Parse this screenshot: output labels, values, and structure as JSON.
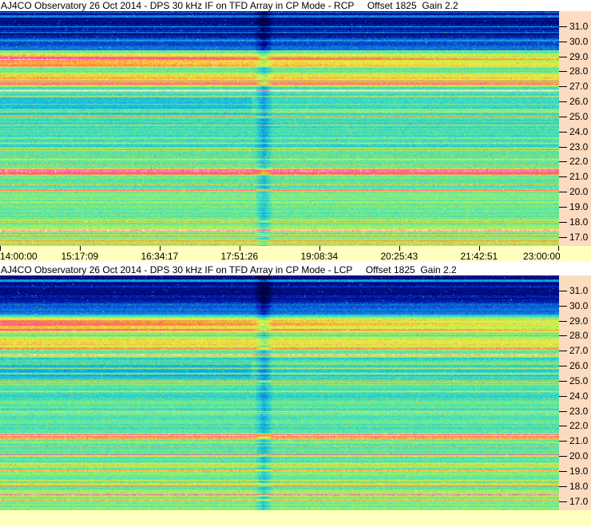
{
  "chart_data": [
    {
      "type": "heatmap",
      "title": "AJ4CO Observatory 26 Oct 2014 - DPS 30 kHz IF on TFD Array in CP Mode - RCP     Offset 1825  Gain 2.2",
      "y_ticks": [
        "31.0",
        "30.0",
        "29.0",
        "28.0",
        "27.0",
        "26.0",
        "25.0",
        "24.0",
        "23.0",
        "22.0",
        "21.0",
        "20.0",
        "19.0",
        "18.0",
        "17.0"
      ],
      "x_ticks": [
        "14:00:00",
        "15:17:09",
        "16:34:17",
        "17:51:26",
        "19:08:34",
        "20:25:43",
        "21:42:51",
        "23:00:00"
      ],
      "x_range": [
        "14:00:00",
        "23:00:00"
      ],
      "y_range": [
        16.4,
        32.0
      ],
      "polarization": "RCP"
    },
    {
      "type": "heatmap",
      "title": "AJ4CO Observatory 26 Oct 2014 - DPS 30 kHz IF on TFD Array in CP Mode - LCP     Offset 1825  Gain 2.2",
      "y_ticks": [
        "31.0",
        "30.0",
        "29.0",
        "28.0",
        "27.0",
        "26.0",
        "25.0",
        "24.0",
        "23.0",
        "22.0",
        "21.0",
        "20.0",
        "19.0",
        "18.0",
        "17.0"
      ],
      "x_ticks": [],
      "x_range": [
        "14:00:00",
        "23:00:00"
      ],
      "y_range": [
        16.4,
        32.0
      ],
      "polarization": "LCP"
    }
  ],
  "colors": {
    "axis_bg_right": "#fcdcc0",
    "axis_bg_bottom": "#ffffc0",
    "colormap": [
      "#000040",
      "#0010a0",
      "#1060e0",
      "#10b0e0",
      "#40e0c0",
      "#a0f060",
      "#f0f040",
      "#ff8040",
      "#ff40c0",
      "#ffffff"
    ]
  }
}
